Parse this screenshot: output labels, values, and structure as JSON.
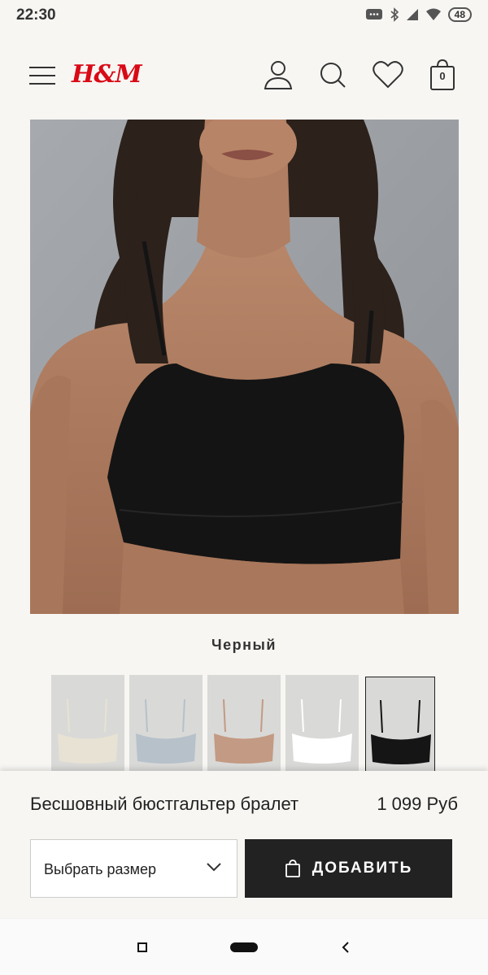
{
  "status_bar": {
    "time": "22:30",
    "battery": "48"
  },
  "header": {
    "logo": "H&M",
    "bag_count": "0"
  },
  "product": {
    "color_name": "Черный",
    "name": "Бесшовный бюстгальтер бралет",
    "price": "1 099 Руб"
  },
  "swatches": [
    {
      "color": "#e7e2d4",
      "selected": false
    },
    {
      "color": "#b6c1ca",
      "selected": false
    },
    {
      "color": "#c39a83",
      "selected": false
    },
    {
      "color": "#ffffff",
      "selected": false
    },
    {
      "color": "#151515",
      "selected": true
    }
  ],
  "size_select": {
    "label": "Выбрать размер"
  },
  "add_button": {
    "label": "ДОБАВИТЬ"
  },
  "colors": {
    "brand": "#d90a16",
    "button": "#222222"
  }
}
